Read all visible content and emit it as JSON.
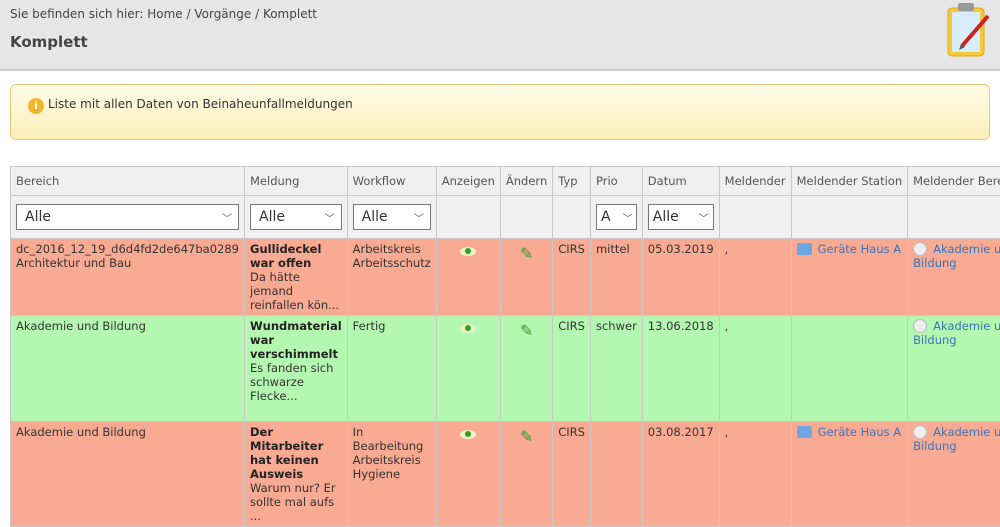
{
  "header": {
    "breadcrumb": "Sie befinden sich hier:  Home / Vorgänge / Komplett",
    "title": "Komplett",
    "icon": "clipboard-pencil-icon"
  },
  "info": {
    "text": "Liste mit allen Daten von Beinaheunfallmeldungen",
    "icon": "info-icon"
  },
  "table": {
    "columns": [
      "Bereich",
      "Meldung",
      "Workflow",
      "Anzeigen",
      "Ändern",
      "Typ",
      "Prio",
      "Datum",
      "Meldender",
      "Meldender Station",
      "Meldender Bereich"
    ],
    "filters": {
      "bereich": "Alle",
      "meldung": "Alle",
      "workflow": "Alle",
      "prio": "A",
      "datum": "Alle"
    },
    "rows": [
      {
        "status": "red",
        "bereich1": "dc_2016_12_19_d6d4fd2de647ba0289",
        "bereich2": "Architektur und Bau",
        "titel": "Gullideckel war offen",
        "text": "Da hätte jemand reinfallen kön...",
        "workflow": "Arbeitskreis Arbeitsschutz",
        "typ": "CIRS",
        "prio": "mittel",
        "datum": "05.03.2019",
        "meldender": ",",
        "station": "Geräte Haus A",
        "mbereich": "Akademie und Bildung"
      },
      {
        "status": "green",
        "bereich1": "Akademie und Bildung",
        "bereich2": "",
        "titel": "Wundmaterial war verschimmelt",
        "text": "Es fanden sich schwarze Flecke...",
        "workflow": "Fertig",
        "typ": "CIRS",
        "prio": "schwer",
        "datum": "13.06.2018",
        "meldender": ",",
        "station": "",
        "mbereich": "Akademie und Bildung"
      },
      {
        "status": "red",
        "bereich1": "Akademie und Bildung",
        "bereich2": "",
        "titel": "Der Mitarbeiter hat keinen Ausweis",
        "text": "Warum nur? Er sollte mal aufs ...",
        "workflow": "In Bearbeitung Arbeitskreis Hygiene",
        "typ": "CIRS",
        "prio": "",
        "datum": "03.08.2017",
        "meldender": ",",
        "station": "Geräte Haus A",
        "mbereich": "Akademie und Bildung"
      }
    ]
  },
  "colors": {
    "red_row": "#f9aa93",
    "green_row": "#b4f7b1",
    "link": "#3a74b8"
  }
}
